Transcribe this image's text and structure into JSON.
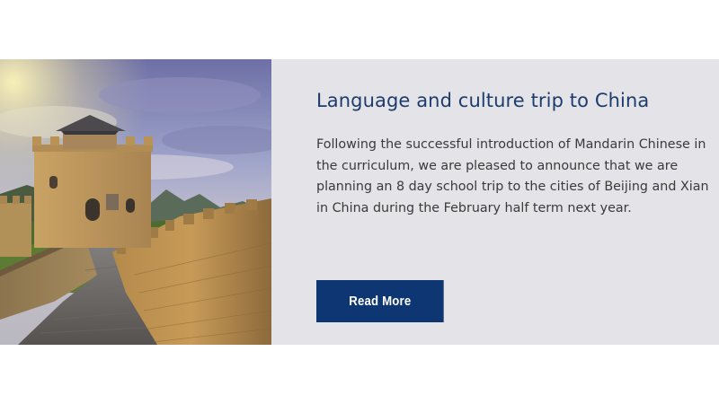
{
  "article": {
    "title": "Language and culture trip to China",
    "body": "Following the successful introduction of Mandarin Chinese in the curriculum, we are pleased to announce that we are planning an 8 day school trip to the cities of Beijing and Xian in China during the February half term next year.",
    "read_more_label": "Read More",
    "image_subject": "great-wall-of-china-photo"
  },
  "colors": {
    "title": "#1d3c6e",
    "button_bg": "#0e3673",
    "card_bg": "#e4e4e8",
    "body_text": "#3a3a3a"
  }
}
